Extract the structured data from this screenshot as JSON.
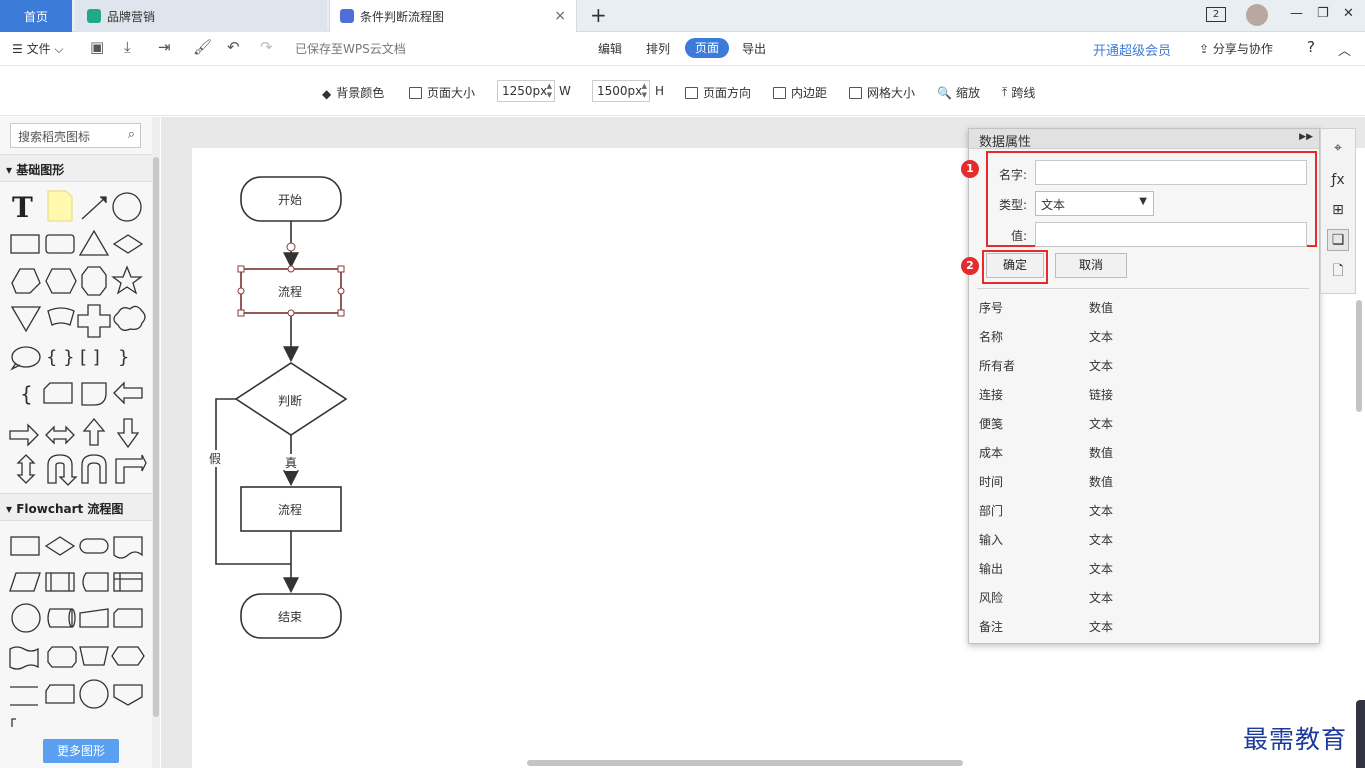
{
  "tabs": {
    "home": "首页",
    "brand": "品牌营销",
    "flow": "条件判断流程图",
    "close": "×",
    "add": "+",
    "counter": "2"
  },
  "toolbar": {
    "file": "文件",
    "saved": "已保存至WPS云文档",
    "nav": [
      "编辑",
      "排列",
      "页面",
      "导出"
    ],
    "vip": "开通超级会员",
    "share": "分享与协作",
    "help": "?"
  },
  "ribbon": {
    "bg_color": "背景颜色",
    "page_size": "页面大小",
    "width_val": "1250px",
    "width_unit": "W",
    "height_val": "1500px",
    "height_unit": "H",
    "orientation": "页面方向",
    "margin": "内边距",
    "grid": "网格大小",
    "zoom": "缩放",
    "cross": "跨线"
  },
  "sidebar": {
    "search_placeholder": "搜索稻壳图标",
    "section_basic": "基础图形",
    "section_flow": "Flowchart 流程图",
    "more": "更多图形"
  },
  "flowchart": {
    "start": "开始",
    "process1": "流程",
    "decision": "判断",
    "true_label": "真",
    "false_label": "假",
    "process2": "流程",
    "end": "结束"
  },
  "panel": {
    "title": "数据属性",
    "badge1": "1",
    "badge2": "2",
    "name_label": "名字:",
    "type_label": "类型:",
    "type_value": "文本",
    "value_label": "值:",
    "ok": "确定",
    "cancel": "取消",
    "rows": [
      {
        "k": "序号",
        "v": "数值"
      },
      {
        "k": "名称",
        "v": "文本"
      },
      {
        "k": "所有者",
        "v": "文本"
      },
      {
        "k": "连接",
        "v": "链接"
      },
      {
        "k": "便笺",
        "v": "文本"
      },
      {
        "k": "成本",
        "v": "数值"
      },
      {
        "k": "时间",
        "v": "数值"
      },
      {
        "k": "部门",
        "v": "文本"
      },
      {
        "k": "输入",
        "v": "文本"
      },
      {
        "k": "输出",
        "v": "文本"
      },
      {
        "k": "风险",
        "v": "文本"
      },
      {
        "k": "备注",
        "v": "文本"
      }
    ]
  },
  "watermark": "最需教育",
  "colors": {
    "accent": "#3d7bd8",
    "highlight_red": "#e32d2d"
  }
}
